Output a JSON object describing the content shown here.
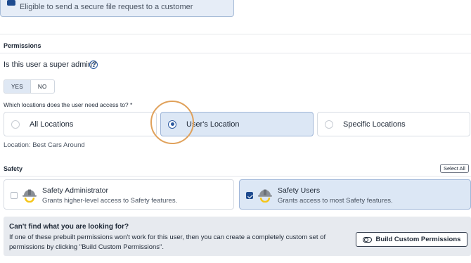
{
  "top_card": {
    "text": "Eligible to send a secure file request to a customer"
  },
  "permissions": {
    "title": "Permissions"
  },
  "super_admin": {
    "question": "Is this user a super admin?",
    "help_icon": "?",
    "options": [
      "YES",
      "NO"
    ],
    "selected": "YES"
  },
  "locations": {
    "question": "Which locations does the user need access to? *",
    "options": [
      {
        "label": "All Locations",
        "selected": false
      },
      {
        "label": "User's Location",
        "selected": true
      },
      {
        "label": "Specific Locations",
        "selected": false
      }
    ],
    "current_location": "Location: Best Cars Around"
  },
  "safety": {
    "title": "Safety",
    "select_all": "Select All",
    "items": [
      {
        "title": "Safety Administrator",
        "description": "Grants higher-level access to Safety features.",
        "checked": false,
        "icon": "hard-hat-icon"
      },
      {
        "title": "Safety Users",
        "description": "Grants access to most Safety features.",
        "checked": true,
        "icon": "hard-hat-icon"
      }
    ]
  },
  "custom": {
    "title": "Can't find what you are looking for?",
    "text": "If one of these prebuilt permissions won't work for this user, then you can create a completely custom set of permissions by clicking \"Build Custom Permissions\".",
    "button_label": "Build Custom Permissions",
    "button_icon": "toggle-icon"
  },
  "colors": {
    "accent": "#2c5aa0",
    "selected_bg": "#dce7f5",
    "highlight_ring": "#e0a15a",
    "info_bg": "#e7eaef"
  }
}
